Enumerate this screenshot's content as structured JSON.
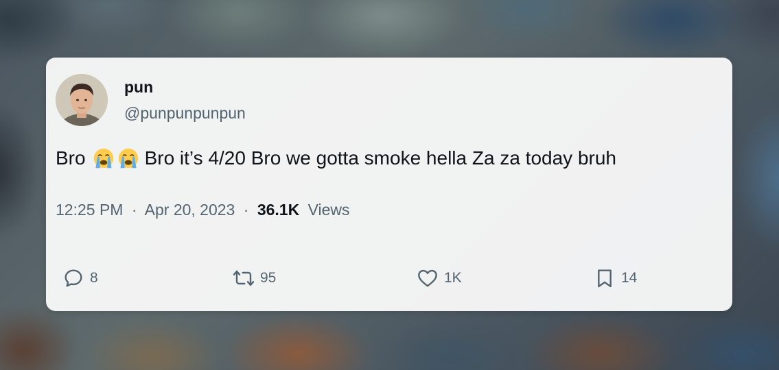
{
  "tweet": {
    "display_name": "pun",
    "handle": "@punpunpunpun",
    "text_start": "Bro",
    "emoji": "loudly-crying-face",
    "text_end": "Bro it’s 4/20 Bro we gotta smoke hella Za za today bruh",
    "time": "12:25 PM",
    "separator": "·",
    "date": "Apr 20, 2023",
    "views_count": "36.1K",
    "views_label": "Views"
  },
  "actions": {
    "replies": "8",
    "retweets": "95",
    "likes": "1K",
    "bookmarks": "14"
  },
  "colors": {
    "text_primary": "#0f1419",
    "text_secondary": "#536471",
    "card_bg": "#fafafa"
  }
}
